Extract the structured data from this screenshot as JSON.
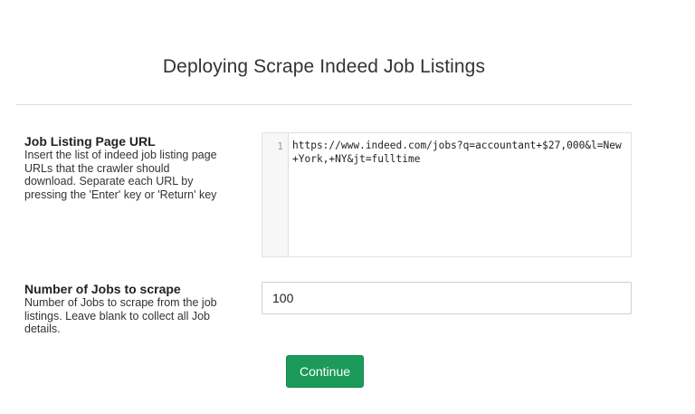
{
  "page": {
    "title": "Deploying Scrape Indeed Job Listings"
  },
  "fields": {
    "urls": {
      "label": "Job Listing Page URL",
      "help": "Insert the list of indeed job listing page URLs that the crawler should download. Separate each URL by pressing the 'Enter' key or 'Return' key",
      "line_number": "1",
      "value": "https://www.indeed.com/jobs?q=accountant+$27,000&l=New+York,+NY&jt=fulltime"
    },
    "num_jobs": {
      "label": "Number of Jobs to scrape",
      "help": "Number of Jobs to scrape from the job listings. Leave blank to collect all Job details.",
      "value": "100"
    }
  },
  "actions": {
    "continue_label": "Continue"
  },
  "colors": {
    "primary_button": "#1b9a59"
  }
}
